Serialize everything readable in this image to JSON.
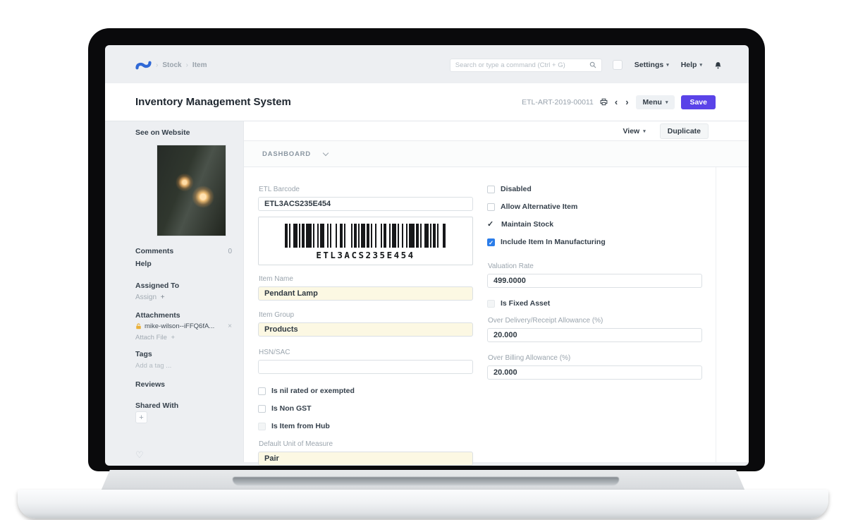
{
  "colors": {
    "accent": "#5a43e8",
    "checkbox_checked": "#2b7de9",
    "attachment_icon": "#eab038",
    "logo_blue": "#3069d6"
  },
  "icons": {
    "plus": "+",
    "close": "×",
    "check": "✓",
    "heart": "♡",
    "caret": "▾",
    "chevron_left": "‹",
    "chevron_right": "›"
  },
  "navbar": {
    "breadcrumb": [
      "Stock",
      "Item"
    ],
    "search_placeholder": "Search or type a command (Ctrl + G)",
    "settings_label": "Settings",
    "help_label": "Help"
  },
  "header": {
    "title": "Inventory Management System",
    "doc_id": "ETL-ART-2019-00011",
    "menu_label": "Menu",
    "save_label": "Save"
  },
  "toolbar": {
    "view_label": "View",
    "duplicate_label": "Duplicate"
  },
  "sidebar": {
    "see_on_website": "See on Website",
    "comments_label": "Comments",
    "comments_count": "0",
    "help_label": "Help",
    "assigned_to_label": "Assigned To",
    "assign_label": "Assign",
    "attachments_label": "Attachments",
    "attachment_file": "mike-wilson--iFFQ6fA...",
    "attach_file_label": "Attach File",
    "tags_label": "Tags",
    "add_tag_label": "Add a tag ...",
    "reviews_label": "Reviews",
    "shared_with_label": "Shared With"
  },
  "main": {
    "dashboard_label": "DASHBOARD",
    "form": {
      "etl_barcode": {
        "label": "ETL Barcode",
        "value": "ETL3ACS235E454"
      },
      "barcode_caption": "ETL3ACS235E454",
      "item_name": {
        "label": "Item Name",
        "value": "Pendant Lamp"
      },
      "item_group": {
        "label": "Item Group",
        "value": "Products"
      },
      "hsn_sac": {
        "label": "HSN/SAC",
        "value": ""
      },
      "left_checkboxes": [
        {
          "label": "Is nil rated or exempted",
          "checked": false
        },
        {
          "label": "Is Non GST",
          "checked": false
        },
        {
          "label": "Is Item from Hub",
          "checked": false
        }
      ],
      "default_uom": {
        "label": "Default Unit of Measure",
        "value": "Pair"
      },
      "right_checkboxes": [
        {
          "label": "Disabled",
          "checked": false
        },
        {
          "label": "Allow Alternative Item",
          "checked": false
        },
        {
          "label": "Maintain Stock",
          "checked": true
        },
        {
          "label": "Include Item In Manufacturing",
          "checked": true
        }
      ],
      "valuation_rate": {
        "label": "Valuation Rate",
        "value": "499.0000"
      },
      "is_fixed_asset": {
        "label": "Is Fixed Asset",
        "checked": false
      },
      "over_delivery": {
        "label": "Over Delivery/Receipt Allowance (%)",
        "value": "20.000"
      },
      "over_billing": {
        "label": "Over Billing Allowance (%)",
        "value": "20.000"
      }
    }
  }
}
